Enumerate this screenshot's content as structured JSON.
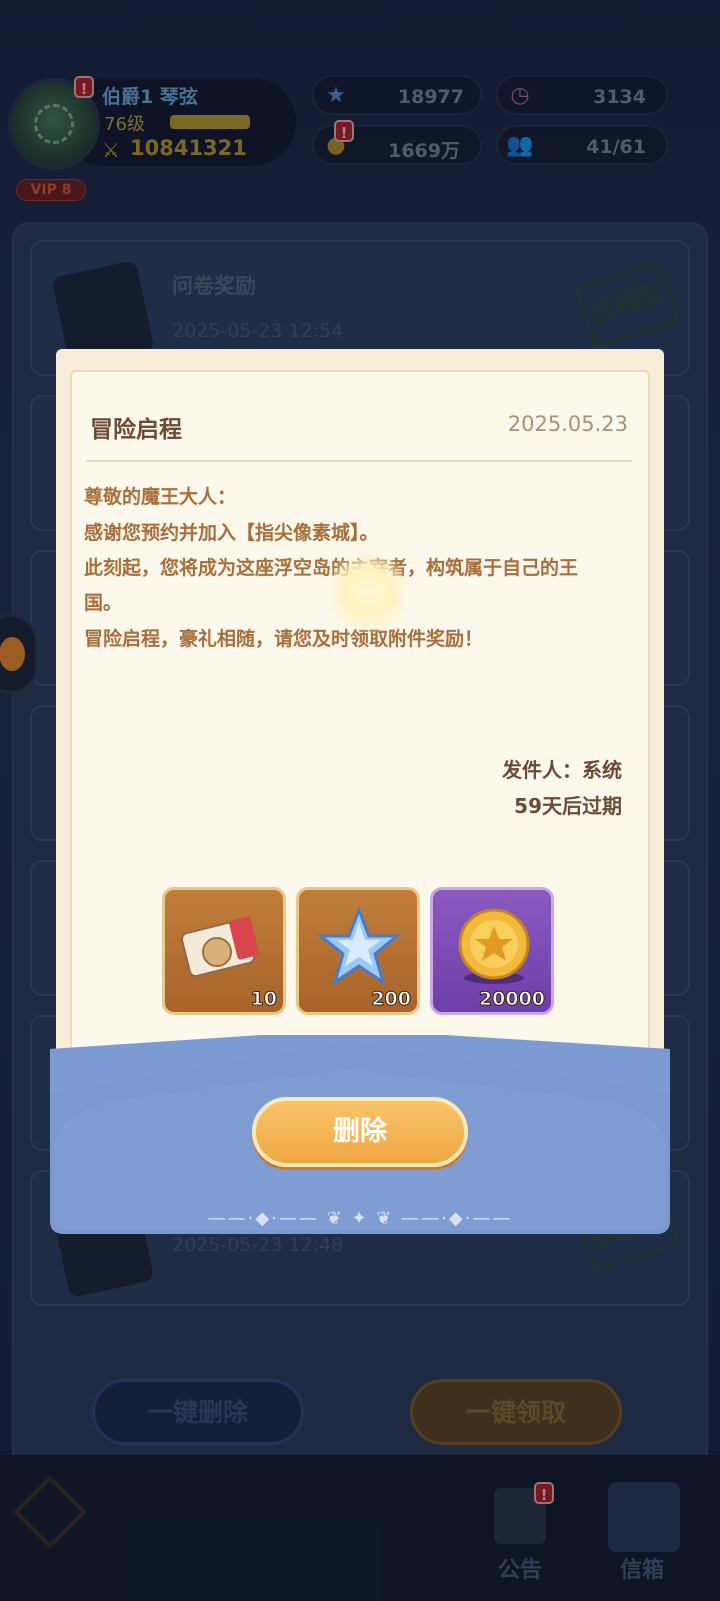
{
  "player": {
    "title": "伯爵1",
    "name": "琴弦",
    "level": "76级",
    "power": "10841321",
    "vip": "VIP 8"
  },
  "resources": [
    {
      "icon": "star-crystal-icon",
      "value": "18977"
    },
    {
      "icon": "stamina-clock-icon",
      "value": "3134"
    },
    {
      "icon": "gold-coin-icon",
      "value": "1669万"
    },
    {
      "icon": "population-icon",
      "value": "41/61"
    }
  ],
  "mail_list": {
    "items": [
      {
        "title": "问卷奖励",
        "date": "2025-05-23 12:54",
        "status": "已领取"
      },
      {
        "title": "",
        "date": "2025-05-23 12:48",
        "status": "已领取"
      }
    ],
    "delete_all_label": "一键删除",
    "claim_all_label": "一键领取"
  },
  "bottom_nav": {
    "announcement_label": "公告",
    "mailbox_label": "信箱",
    "badge": "!"
  },
  "mail_detail": {
    "subject": "冒险启程",
    "date": "2025.05.23",
    "body": [
      "尊敬的魔王大人：",
      "感谢您预约并加入【指尖像素城】。",
      "此刻起，您将成为这座浮空岛的主宰者，构筑属于自己的王",
      "国。",
      "冒险启程，豪礼相随，请您及时领取附件奖励！"
    ],
    "sender": "发件人：系统",
    "expire": "59天后过期",
    "rewards": [
      {
        "icon": "ticket-icon",
        "qty": "10"
      },
      {
        "icon": "blue-star-icon",
        "qty": "200"
      },
      {
        "icon": "gold-coin-icon",
        "qty": "20000"
      }
    ],
    "delete_label": "删除"
  },
  "colors": {
    "paper": "#fdf8ec",
    "envelope_blue": "#7d9bd3",
    "button_orange": "#f0a744",
    "body_text": "#a86f3c"
  }
}
